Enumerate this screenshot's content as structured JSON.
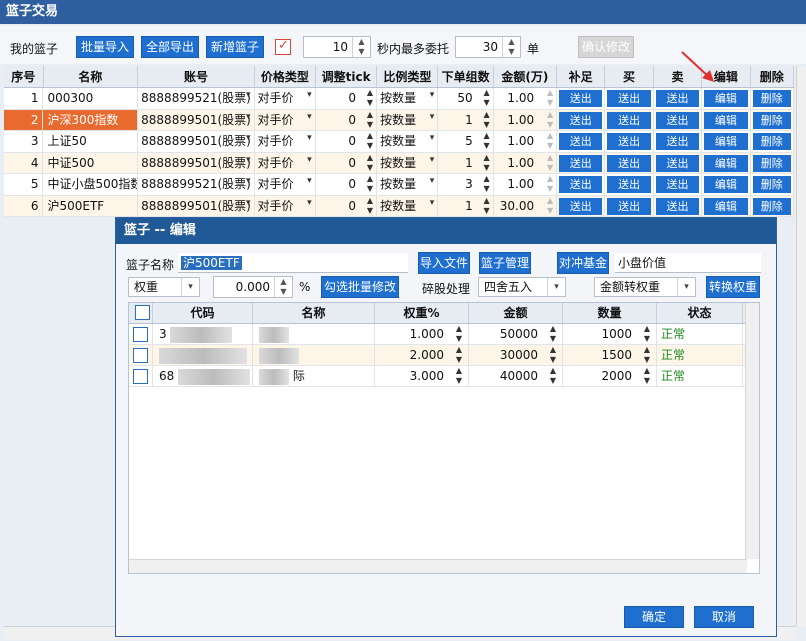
{
  "window": {
    "title": "篮子交易"
  },
  "toolbar": {
    "my_basket_label": "我的篮子",
    "batch_import": "批量导入",
    "export_all": "全部导出",
    "new_basket": "新增篮子",
    "seconds_value": "10",
    "seconds_label": "秒内最多委托",
    "count_value": "30",
    "count_unit": "单",
    "confirm_modify": "确认修改"
  },
  "grid": {
    "headers": [
      "序号",
      "名称",
      "账号",
      "价格类型",
      "调整tick",
      "比例类型",
      "下单组数",
      "金额(万)",
      "补足",
      "买",
      "卖",
      "编辑",
      "删除"
    ],
    "rows": [
      {
        "idx": "1",
        "name": "000300",
        "account": "8888899521(股票)",
        "price_type": "对手价",
        "tick": "0",
        "ratio_type": "按数量",
        "groups": "50",
        "amount": "1.00"
      },
      {
        "idx": "2",
        "name": "沪深300指数",
        "account": "8888899501(股票)",
        "price_type": "对手价",
        "tick": "0",
        "ratio_type": "按数量",
        "groups": "1",
        "amount": "1.00"
      },
      {
        "idx": "3",
        "name": "上证50",
        "account": "8888899501(股票)",
        "price_type": "对手价",
        "tick": "0",
        "ratio_type": "按数量",
        "groups": "5",
        "amount": "1.00"
      },
      {
        "idx": "4",
        "name": "中证500",
        "account": "8888899501(股票)",
        "price_type": "对手价",
        "tick": "0",
        "ratio_type": "按数量",
        "groups": "1",
        "amount": "1.00"
      },
      {
        "idx": "5",
        "name": "中证小盘500指数",
        "account": "8888899521(股票)",
        "price_type": "对手价",
        "tick": "0",
        "ratio_type": "按数量",
        "groups": "3",
        "amount": "1.00"
      },
      {
        "idx": "6",
        "name": "沪500ETF",
        "account": "8888899501(股票)",
        "price_type": "对手价",
        "tick": "0",
        "ratio_type": "按数量",
        "groups": "1",
        "amount": "30.00"
      }
    ],
    "action_send": "送出",
    "action_edit": "编辑",
    "action_delete": "删除"
  },
  "dialog": {
    "title": "篮子 -- 编辑",
    "basket_name_label": "篮子名称",
    "basket_name_value": "沪500ETF",
    "import_file": "导入文件",
    "basket_manage": "篮子管理",
    "hedge_fund": "对冲基金",
    "small_cap_value": "小盘价值",
    "weight_select": "权重",
    "weight_value": "0.000",
    "percent": "%",
    "batch_modify": "勾选批量修改",
    "odd_lot_label": "碎股处理",
    "odd_lot_value": "四舍五入",
    "amount_to_weight": "金额转权重",
    "convert_weight": "转换权重",
    "table_headers": [
      "代码",
      "名称",
      "权重%",
      "金额",
      "数量",
      "状态"
    ],
    "table_rows": [
      {
        "code": "3",
        "weight": "1.000",
        "amount": "50000",
        "qty": "1000",
        "status": "正常"
      },
      {
        "code": "",
        "weight": "2.000",
        "amount": "30000",
        "qty": "1500",
        "status": "正常"
      },
      {
        "code": "68",
        "name_suffix": "际",
        "weight": "3.000",
        "amount": "40000",
        "qty": "2000",
        "status": "正常"
      }
    ],
    "ok": "确定",
    "cancel": "取消"
  },
  "colors": {
    "title_bar": "#2f5f9e",
    "accent": "#1f6fd1",
    "selected_row": "#e86a2e",
    "status_ok": "#1f8a1f"
  }
}
